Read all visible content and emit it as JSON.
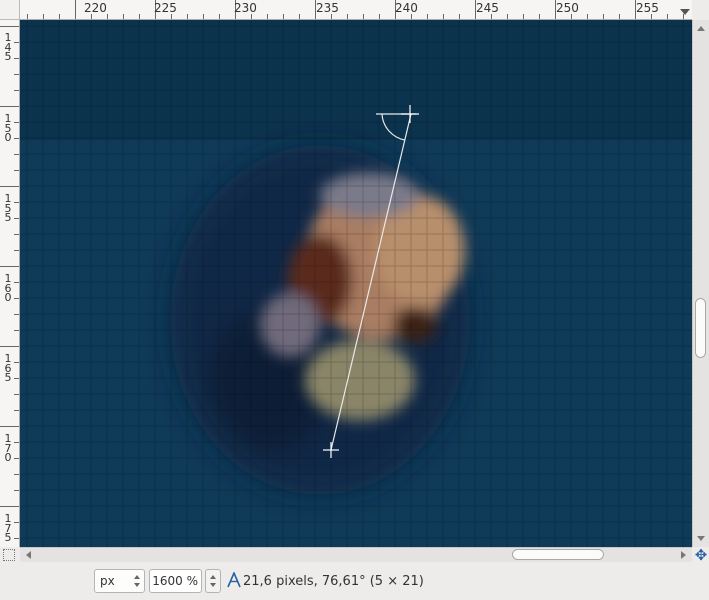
{
  "rulers": {
    "horizontal": [
      "220",
      "225",
      "230",
      "235",
      "240",
      "245",
      "250",
      "255"
    ],
    "vertical": [
      "145",
      "150",
      "155",
      "160",
      "165",
      "170",
      "175"
    ]
  },
  "canvas": {
    "measure_start": [
      241,
      114
    ],
    "measure_end": [
      236,
      135
    ],
    "image_description": "zoomed pixelated brownish blob on dark blue"
  },
  "statusbar": {
    "unit": "px",
    "zoom": "1600 %",
    "measurement": "21,6 pixels, 76,61° (5 × 21)"
  },
  "icons": {
    "quick_mask": "quick-mask-icon",
    "navigate": "navigate-icon",
    "measure": "measure-tool-icon"
  }
}
